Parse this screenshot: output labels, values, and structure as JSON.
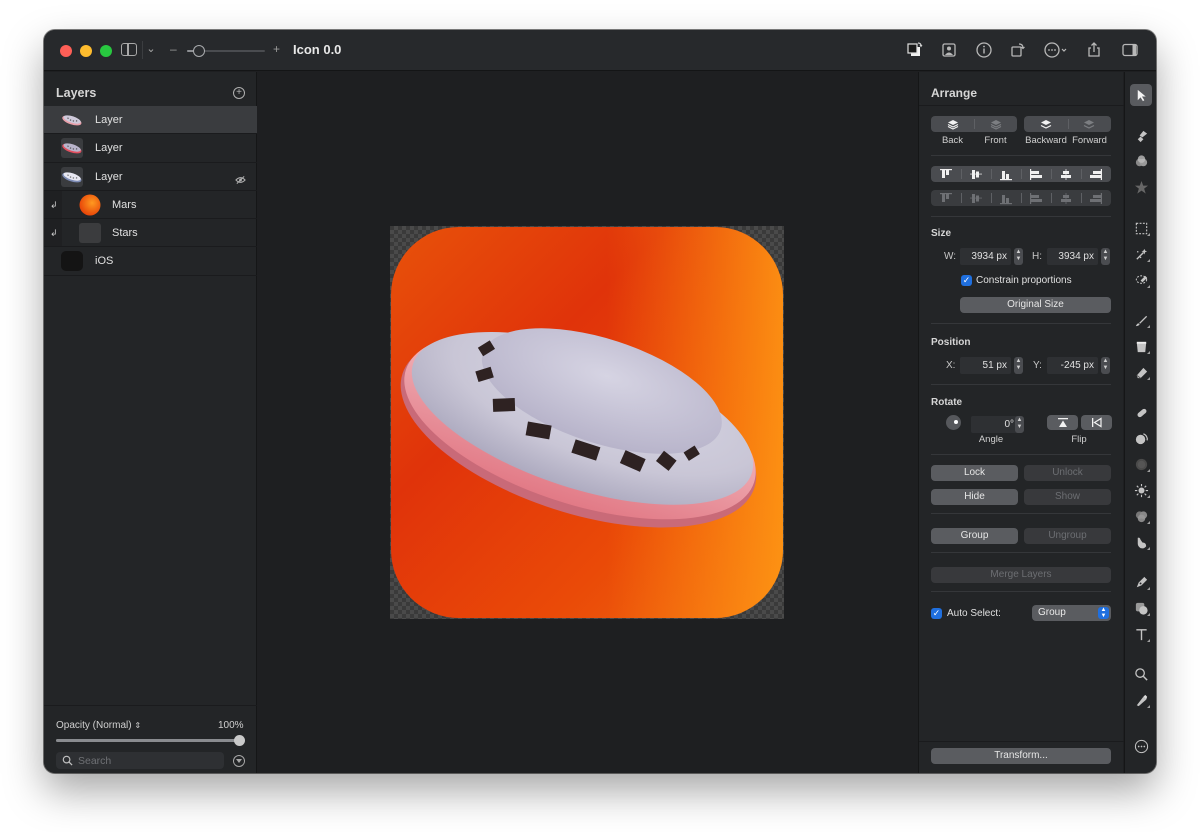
{
  "window": {
    "title": "Icon 0.0",
    "zoom_slider_fraction": 0.15
  },
  "toolbar": {
    "right_icons": [
      "arrange-layers-icon",
      "portrait-icon",
      "info-icon",
      "rotate-canvas-icon",
      "more-options-icon",
      "share-icon",
      "sidebar-right-icon"
    ]
  },
  "layers_panel": {
    "title": "Layers",
    "add_icon": "plus-circle-icon",
    "items": [
      {
        "name": "Layer",
        "thumb": "ufo",
        "selected": true,
        "clipped": false,
        "hidden": false
      },
      {
        "name": "Layer",
        "thumb": "ufo-pink",
        "selected": false,
        "clipped": false,
        "hidden": false
      },
      {
        "name": "Layer",
        "thumb": "ufo-blue",
        "selected": false,
        "clipped": false,
        "hidden": true
      },
      {
        "name": "Mars",
        "thumb": "mars",
        "selected": false,
        "clipped": true,
        "hidden": false
      },
      {
        "name": "Stars",
        "thumb": "stars",
        "selected": false,
        "clipped": true,
        "hidden": false
      },
      {
        "name": "iOS",
        "thumb": "ios",
        "selected": false,
        "clipped": false,
        "hidden": false
      }
    ],
    "opacity_label": "Opacity (Normal)",
    "opacity_value": "100%",
    "opacity_fraction": 1.0,
    "search_placeholder": "Search",
    "search_value": ""
  },
  "arrange_panel": {
    "title": "Arrange",
    "order_buttons": [
      {
        "label": "Back",
        "enabled": true
      },
      {
        "label": "Front",
        "enabled": false
      },
      {
        "label": "Backward",
        "enabled": true
      },
      {
        "label": "Forward",
        "enabled": false
      }
    ],
    "align_row1": [
      "align-top-icon",
      "align-vertical-center-icon",
      "align-bottom-icon",
      "align-left-icon",
      "align-horizontal-center-icon",
      "align-right-icon"
    ],
    "align_row2": [
      "distribute-top-icon",
      "distribute-vertical-center-icon",
      "distribute-bottom-icon",
      "distribute-left-icon",
      "distribute-horizontal-center-icon",
      "distribute-right-icon"
    ],
    "size": {
      "label": "Size",
      "w_label": "W:",
      "w_value": "3934 px",
      "h_label": "H:",
      "h_value": "3934 px",
      "constrain_label": "Constrain proportions",
      "constrain_checked": true,
      "original_size_label": "Original Size"
    },
    "position": {
      "label": "Position",
      "x_label": "X:",
      "x_value": "51 px",
      "y_label": "Y:",
      "y_value": "-245 px"
    },
    "rotate": {
      "label": "Rotate",
      "angle_value": "0°",
      "angle_label": "Angle",
      "flip_label": "Flip"
    },
    "lock_label": "Lock",
    "unlock_label": "Unlock",
    "hide_label": "Hide",
    "show_label": "Show",
    "group_label": "Group",
    "ungroup_label": "Ungroup",
    "merge_label": "Merge Layers",
    "auto_select_label": "Auto Select:",
    "auto_select_checked": true,
    "auto_select_value": "Group",
    "transform_label": "Transform..."
  },
  "tools": [
    "arrow-selection-icon",
    "paint-bucket-style-icon",
    "color-adjust-icon",
    "effects-star-icon",
    "rect-select-icon",
    "magic-wand-icon",
    "lasso-select-icon",
    "brush-icon",
    "fill-bucket-icon",
    "eraser-icon",
    "bandage-repair-icon",
    "clone-icon",
    "blur-icon",
    "light-icon",
    "color-blend-icon",
    "smudge-icon",
    "pen-icon",
    "shape-icon",
    "text-icon",
    "zoom-icon",
    "color-picker-icon",
    "more-tools-icon"
  ]
}
